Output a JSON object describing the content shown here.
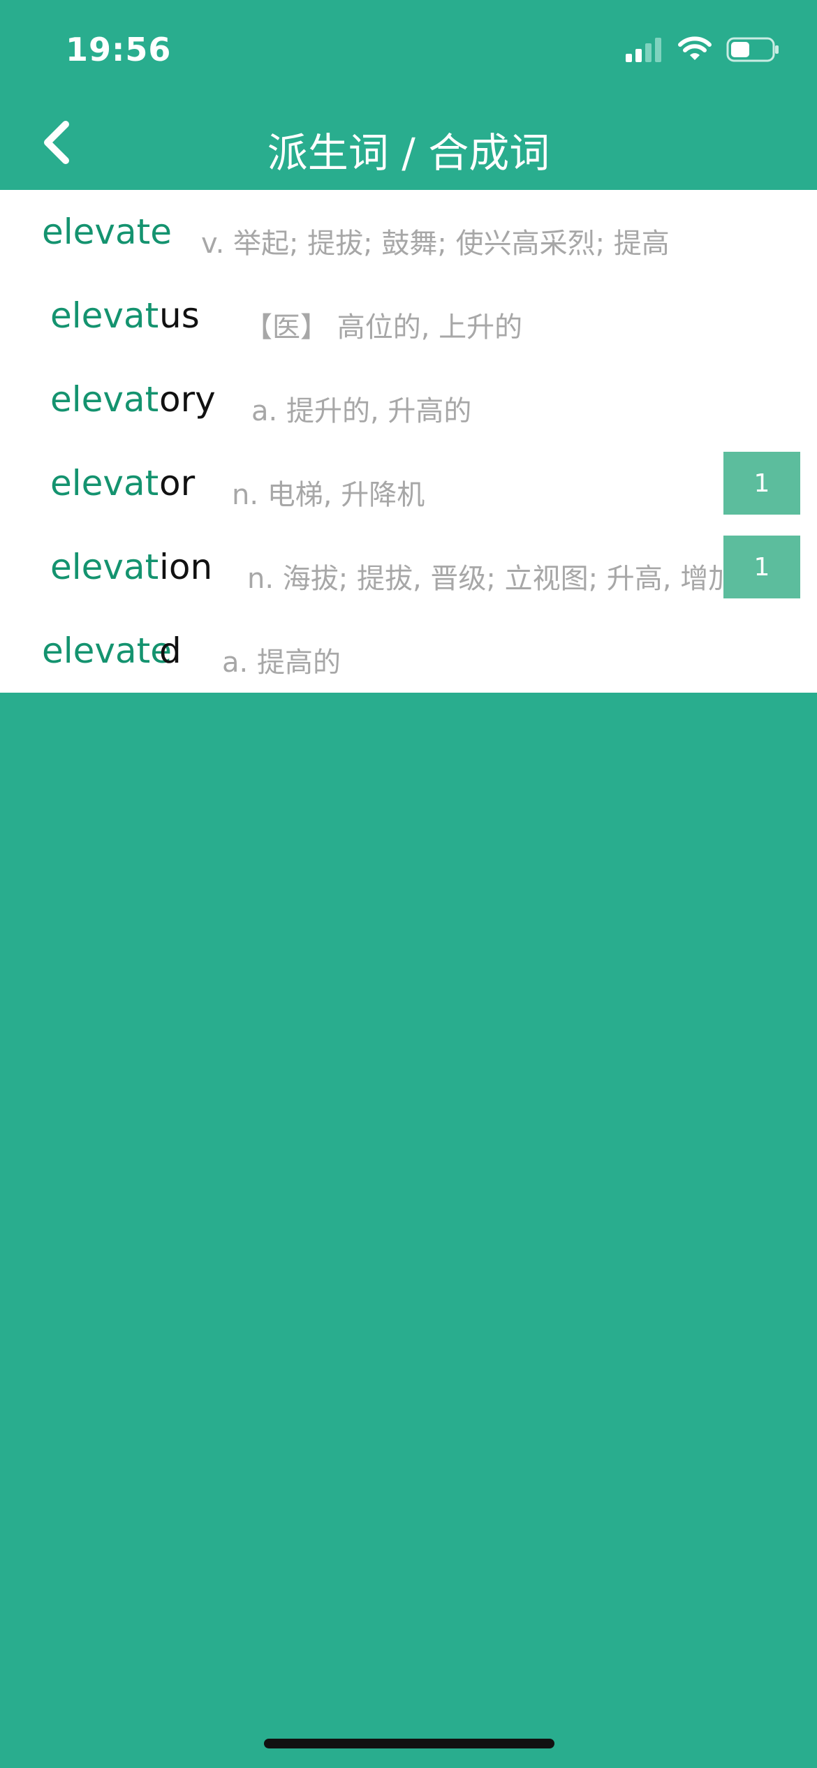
{
  "status_bar": {
    "time": "19:56"
  },
  "nav": {
    "title": "派生词 / 合成词",
    "back_icon": "chevron-left-icon"
  },
  "words": [
    {
      "stem": "elevate",
      "suffix": "",
      "definition": "v. 举起; 提拔; 鼓舞; 使兴高采烈; 提高"
    },
    {
      "stem": "elevat",
      "suffix": "us",
      "definition": "【医】 高位的, 上升的"
    },
    {
      "stem": "elevat",
      "suffix": "ory",
      "definition": "a. 提升的, 升高的"
    },
    {
      "stem": "elevat",
      "suffix": "or",
      "definition": "n. 电梯, 升降机",
      "badge": "1"
    },
    {
      "stem": "elevat",
      "suffix": "ion",
      "definition": "n. 海拔; 提拔, 晋级; 立视图; 升高, 增加",
      "badge": "1"
    },
    {
      "stem": "elevate",
      "suffix": "d",
      "definition": "a. 提高的"
    }
  ],
  "colors": {
    "background": "#29ad8e",
    "stem": "#14936f",
    "badge": "#5cbd9d",
    "definition": "#a7a7a7"
  }
}
